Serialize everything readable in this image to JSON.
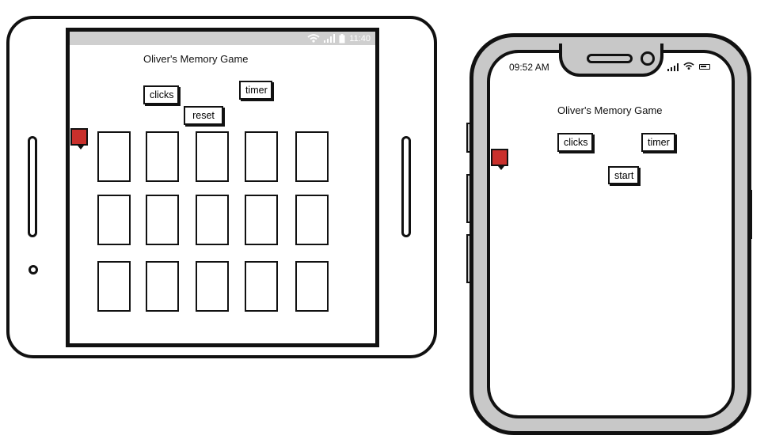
{
  "tablet": {
    "status_time": "11:40",
    "app": {
      "title": "Oliver's Memory Game",
      "clicks_label": "clicks",
      "timer_label": "timer",
      "reset_label": "reset",
      "card_rows": 3,
      "card_columns": 5
    }
  },
  "phone": {
    "status_time": "09:52 AM",
    "app": {
      "title": "Oliver's Memory Game",
      "clicks_label": "clicks",
      "timer_label": "timer",
      "start_label": "start"
    }
  },
  "colors": {
    "frame": "#111111",
    "phone_body": "#c8c8c8",
    "status_bar": "#cfcfcf",
    "flag": "#c9302c"
  },
  "icons": [
    "wifi-icon",
    "signal-icon",
    "battery-icon",
    "home-button-icon",
    "flag-icon"
  ]
}
